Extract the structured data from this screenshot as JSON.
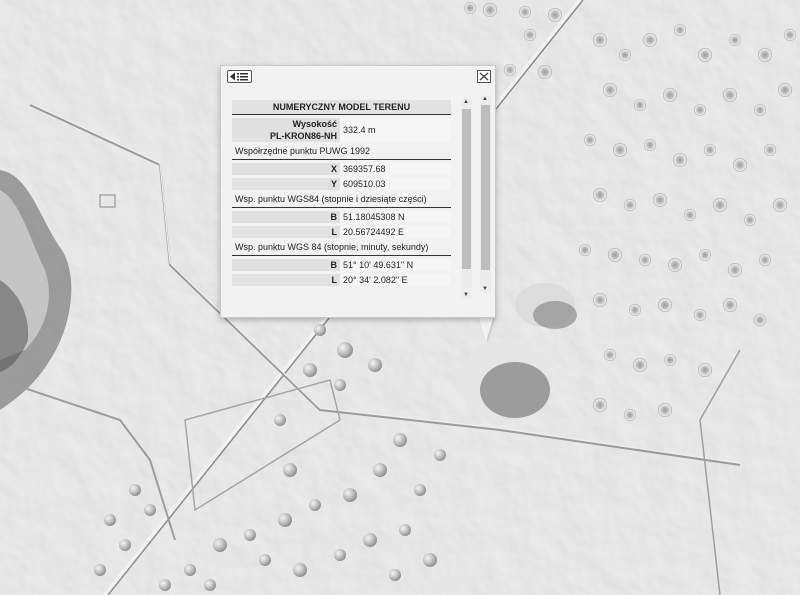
{
  "popup": {
    "title": "NUMERYCZNY MODEL TERENU",
    "height_label": "Wysokość",
    "height_system": "PL-KRON86-NH",
    "height_value": "332.4 m",
    "puwg_header": "Współrzędne punktu PUWG 1992",
    "x_label": "X",
    "x_value": "369357.68",
    "y_label": "Y",
    "y_value": "609510.03",
    "wgs_dec_header": "Wsp. punktu WGS84 (stopnie i dziesiąte części)",
    "b_label": "B",
    "b_dec_value": "51.18045308 N",
    "l_label": "L",
    "l_dec_value": "20.56724492 E",
    "wgs_dms_header": "Wsp. punktu WGS 84 (stopnie, minuty, sekundy)",
    "b_dms_value": "51° 10' 49.631\" N",
    "l_dms_value": "20° 34' 2.082\" E",
    "list_icon": "list-icon",
    "close_icon": "close-icon"
  }
}
